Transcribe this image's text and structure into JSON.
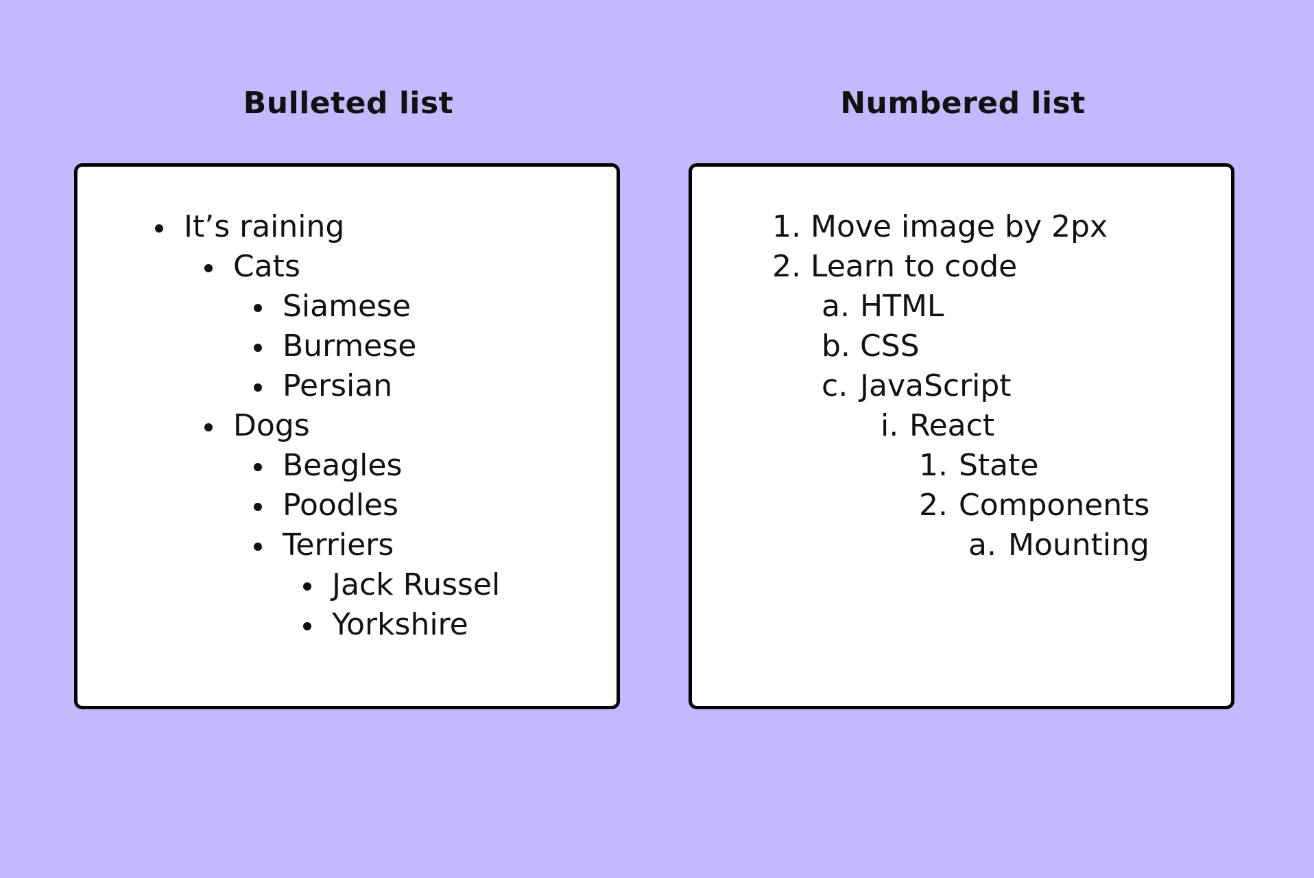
{
  "colors": {
    "background": "#c4b9fe",
    "card": "#ffffff",
    "border": "#000000",
    "text": "#111111"
  },
  "bulleted": {
    "title": "Bulleted list",
    "items": [
      {
        "text": "It’s raining",
        "level": 1
      },
      {
        "text": "Cats",
        "level": 2
      },
      {
        "text": "Siamese",
        "level": 3
      },
      {
        "text": "Burmese",
        "level": 3
      },
      {
        "text": "Persian",
        "level": 3
      },
      {
        "text": "Dogs",
        "level": 2
      },
      {
        "text": "Beagles",
        "level": 3
      },
      {
        "text": "Poodles",
        "level": 3
      },
      {
        "text": "Terriers",
        "level": 3
      },
      {
        "text": "Jack Russel",
        "level": 4
      },
      {
        "text": "Yorkshire",
        "level": 4
      }
    ]
  },
  "numbered": {
    "title": "Numbered list",
    "items": [
      {
        "marker": "1.",
        "text": "Move image by 2px",
        "level": 1
      },
      {
        "marker": "2.",
        "text": "Learn to code",
        "level": 1
      },
      {
        "marker": "a.",
        "text": "HTML",
        "level": 2
      },
      {
        "marker": "b.",
        "text": "CSS",
        "level": 2
      },
      {
        "marker": "c.",
        "text": "JavaScript",
        "level": 2
      },
      {
        "marker": "i.",
        "text": "React",
        "level": 3
      },
      {
        "marker": "1.",
        "text": "State",
        "level": 4
      },
      {
        "marker": "2.",
        "text": "Components",
        "level": 4
      },
      {
        "marker": "a.",
        "text": "Mounting",
        "level": 5
      }
    ]
  }
}
